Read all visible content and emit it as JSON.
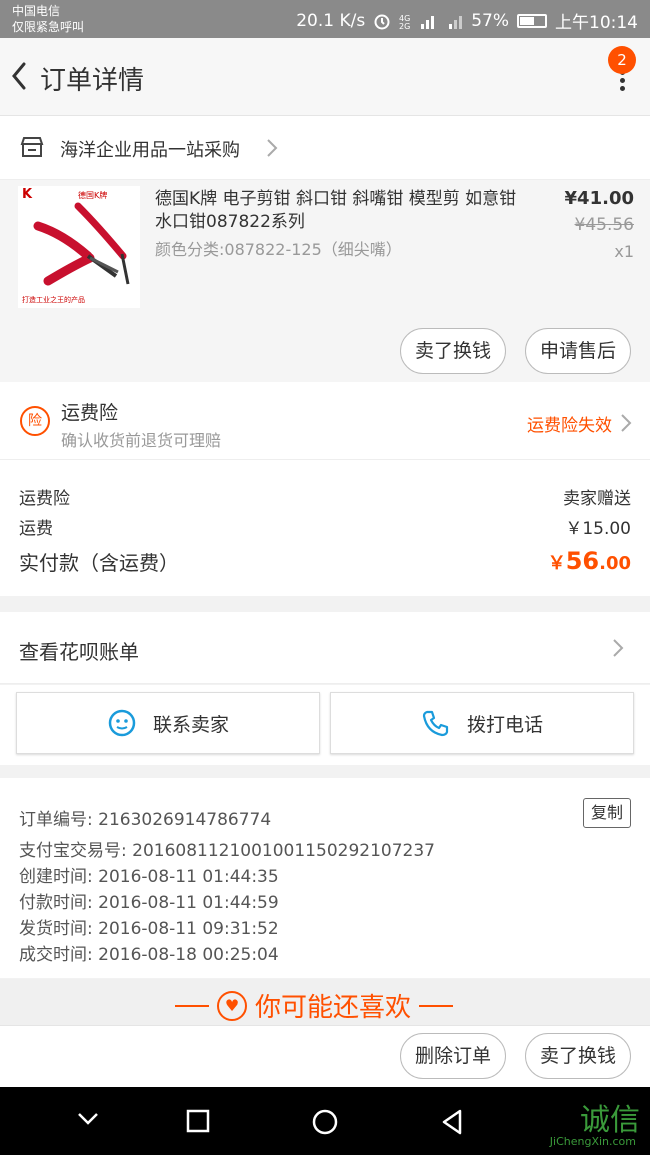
{
  "status_bar": {
    "carrier": "中国电信",
    "emergency": "仅限紧急呼叫",
    "speed": "20.1 K/s",
    "battery": "57%",
    "time": "上午10:14"
  },
  "nav": {
    "title": "订单详情",
    "badge_count": "2"
  },
  "shop": {
    "name": "海洋企业用品一站采购"
  },
  "item": {
    "title": "德国K牌 电子剪钳 斜口钳 斜嘴钳 模型剪 如意钳水口钳087822系列",
    "spec": "颜色分类:087822-125（细尖嘴）",
    "price": "¥41.00",
    "original_price": "¥45.56",
    "quantity": "x1",
    "btn_sell": "卖了换钱",
    "btn_after_sale": "申请售后",
    "image_brand": "德国K牌",
    "image_slogan": "打造工业之王的产品"
  },
  "insurance": {
    "icon_text": "险",
    "title": "运费险",
    "subtitle": "确认收货前退货可理赔",
    "status": "运费险失效"
  },
  "fees": {
    "insurance_label": "运费险",
    "insurance_value": "卖家赠送",
    "shipping_label": "运费",
    "shipping_value": "￥15.00",
    "total_label": "实付款（含运费）",
    "total_currency": "￥",
    "total_int": "56",
    "total_dec": ".00"
  },
  "huabei": {
    "label": "查看花呗账单"
  },
  "actions": {
    "contact": "联系卖家",
    "call": "拨打电话"
  },
  "order_info": {
    "order_no": "订单编号: 2163026914786774",
    "copy": "复制",
    "alipay_no": "支付宝交易号: 2016081121001001150292107237",
    "created": "创建时间: 2016-08-11 01:44:35",
    "paid": "付款时间: 2016-08-11 01:44:59",
    "shipped": "发货时间: 2016-08-11 09:31:52",
    "completed": "成交时间: 2016-08-18 00:25:04"
  },
  "recommend": {
    "title": "你可能还喜欢"
  },
  "bottom_bar": {
    "delete": "删除订单",
    "sell": "卖了换钱"
  },
  "watermark": {
    "text": "诚信",
    "domain": "JiChengXin.com"
  },
  "colors": {
    "accent": "#ff5000",
    "status_bar": "#8a8a8a"
  }
}
